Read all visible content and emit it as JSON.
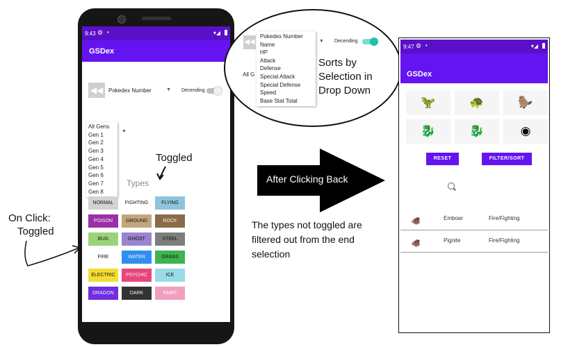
{
  "colors": {
    "status_bar": "#5a10c8",
    "app_bar": "#6414f0",
    "toggle_on": "#19c3ae",
    "button": "#6414f0"
  },
  "phone1": {
    "status": {
      "time": "9:43"
    },
    "app_title": "GSDex",
    "sort": {
      "selected": "Pokedex Number",
      "descending_label": "Decending",
      "descending_on": false
    },
    "gen_options": [
      "All Gens",
      "Gen 1",
      "Gen 2",
      "Gen 3",
      "Gen 4",
      "Gen 5",
      "Gen 6",
      "Gen 7",
      "Gen 8"
    ],
    "types_header": "Types",
    "types": [
      {
        "label": "NORMAL",
        "color": "#d3d3d3"
      },
      {
        "label": "FIGHTING",
        "color": "#ffffff"
      },
      {
        "label": "FLYING",
        "color": "#8fc4de"
      },
      {
        "label": "POISON",
        "color": "#9b2fa6"
      },
      {
        "label": "GROUND",
        "color": "#c2a67c"
      },
      {
        "label": "ROCK",
        "color": "#8a6b45"
      },
      {
        "label": "BUG",
        "color": "#9bd27a"
      },
      {
        "label": "GHOST",
        "color": "#9b83d0"
      },
      {
        "label": "STEEL",
        "color": "#7d7d7d"
      },
      {
        "label": "FIRE",
        "color": "#ffffff"
      },
      {
        "label": "WATER",
        "color": "#2f8ef0"
      },
      {
        "label": "GRASS",
        "color": "#3fb34f"
      },
      {
        "label": "ELECTRIC",
        "color": "#f5dc34"
      },
      {
        "label": "PSYCHIC",
        "color": "#e8467c"
      },
      {
        "label": "ICE",
        "color": "#98dce6"
      },
      {
        "label": "DRAGON",
        "color": "#6f2ee0"
      },
      {
        "label": "DARK",
        "color": "#333333"
      },
      {
        "label": "FAIRY",
        "color": "#f0a0bf"
      }
    ]
  },
  "dropdown_bubble": {
    "sort_options": [
      "Pokedex Number",
      "Name",
      "HP",
      "Attack",
      "Defense",
      "Special Attack",
      "Special Defense",
      "Speed",
      "Base Stat Total"
    ],
    "descending_label": "Decending",
    "descending_on": true,
    "gen_peek": "All G",
    "caption": "Sorts by Selection in Drop Down"
  },
  "annotations": {
    "toggled": "Toggled",
    "on_click": "On Click:",
    "on_click_toggled": "Toggled",
    "after_back": "After Clicking Back",
    "types_note": "The types not toggled are filtered out from the end selection"
  },
  "phone2": {
    "status": {
      "time": "9:47"
    },
    "app_title": "GSDex",
    "sprites": [
      "tyranitar-sprite-icon",
      "grotle-sprite-icon",
      "bibarel-sprite-icon",
      "shiny-sprite-icon",
      "shiny-sprite-icon",
      "unknown-pokeball-icon"
    ],
    "reset_label": "RESET",
    "filter_label": "FILTER/SORT",
    "results": [
      {
        "name": "Emboar",
        "types": "Fire/Fighting"
      },
      {
        "name": "Pignite",
        "types": "Fire/Fighting"
      }
    ]
  }
}
